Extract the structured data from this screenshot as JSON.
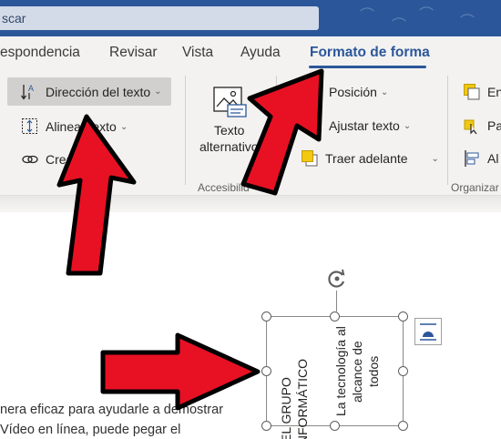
{
  "titlebar": {
    "search_text": "scar"
  },
  "tabs": [
    {
      "label": "espondencia"
    },
    {
      "label": "Revisar"
    },
    {
      "label": "Vista"
    },
    {
      "label": "Ayuda"
    },
    {
      "label": "Formato de forma",
      "active": true
    }
  ],
  "ribbon": {
    "direccion_label": "Dirección del texto",
    "alinear_label": "Alinear texto",
    "crear_label": "Crear",
    "texto_alt_label": [
      "Texto",
      "alternativo"
    ],
    "accesibilidad_label": "Accesibilid",
    "posicion_label": "Posición",
    "ajustar_label": "Ajustar texto",
    "traer_label": "Traer adelante",
    "env_label": "Env",
    "pa_label": "Pa",
    "al_label": "Al",
    "organizar_label": "Organizar"
  },
  "document": {
    "line1": "nera eficaz para ayudarle a demostrar",
    "line2": " Vídeo en línea, puede pegar el"
  },
  "textbox": {
    "col1": [
      "EL GRUPO",
      "INFORMÁTICO"
    ],
    "col2": [
      "La tecnología al",
      "alcance de",
      "todos"
    ]
  },
  "colors": {
    "accent": "#2b579a",
    "arrow_fill": "#e81123",
    "arrow_outline": "#000000"
  },
  "icons": [
    "text-direction-icon",
    "align-text-icon",
    "create-link-icon",
    "alt-text-icon",
    "position-icon",
    "wrap-text-icon",
    "bring-forward-icon",
    "rotate-handle-icon",
    "layout-options-icon"
  ]
}
